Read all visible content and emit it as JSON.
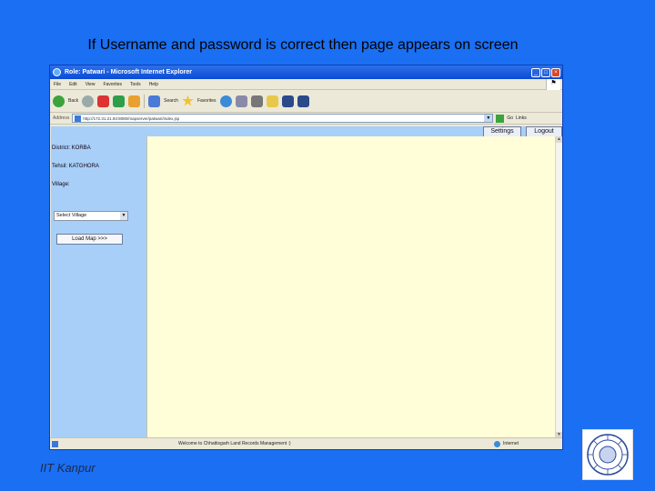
{
  "slide": {
    "title": "If Username and password is correct then page appears on screen",
    "footer": "IIT Kanpur"
  },
  "browser": {
    "title": "Role: Patwari - Microsoft Internet Explorer",
    "menu": [
      "File",
      "Edit",
      "View",
      "Favorites",
      "Tools",
      "Help"
    ],
    "toolbar": {
      "back_label": "Back",
      "search_label": "Search",
      "favorites_label": "Favorites"
    },
    "address": {
      "label": "Address",
      "url": "http://172.31.21.93:8080/mapserver/patwari/index.jsp",
      "go_label": "Go",
      "links_label": "Links"
    },
    "status": {
      "message": "Welcome to Chhattisgarh Land Records Management :)",
      "zone": "Internet"
    }
  },
  "app": {
    "settings_label": "Settings",
    "logout_label": "Logout",
    "district": "District: KORBA",
    "tehsil": "Tehsil: KATGHORA",
    "village_label": "Village:",
    "village_select": "Select Village",
    "load_map_label": "Load Map >>>"
  }
}
